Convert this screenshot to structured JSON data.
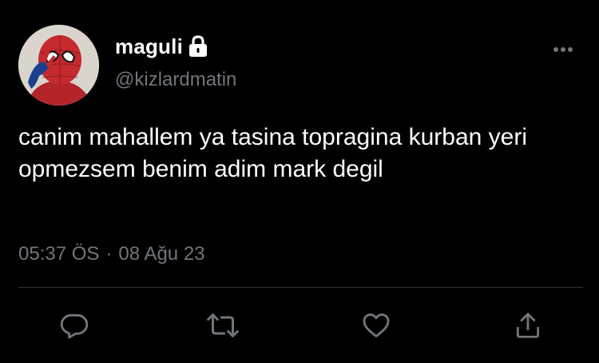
{
  "tweet": {
    "display_name": "maguli",
    "handle": "@kizlardmatin",
    "text": "canim mahallem ya tasina topragina kurban yeri opmezsem benim adim mark degil",
    "time": "05:37 ÖS",
    "separator": "·",
    "date": "08 Ağu 23"
  },
  "icons": {
    "verified_or_lock": "lock-icon",
    "more": "more-horizontal-icon",
    "reply": "reply-icon",
    "retweet": "retweet-icon",
    "like": "heart-icon",
    "share": "share-icon"
  },
  "colors": {
    "background": "#000000",
    "primary_text": "#ffffff",
    "secondary_text": "#71767b",
    "divider": "#2f3336"
  }
}
